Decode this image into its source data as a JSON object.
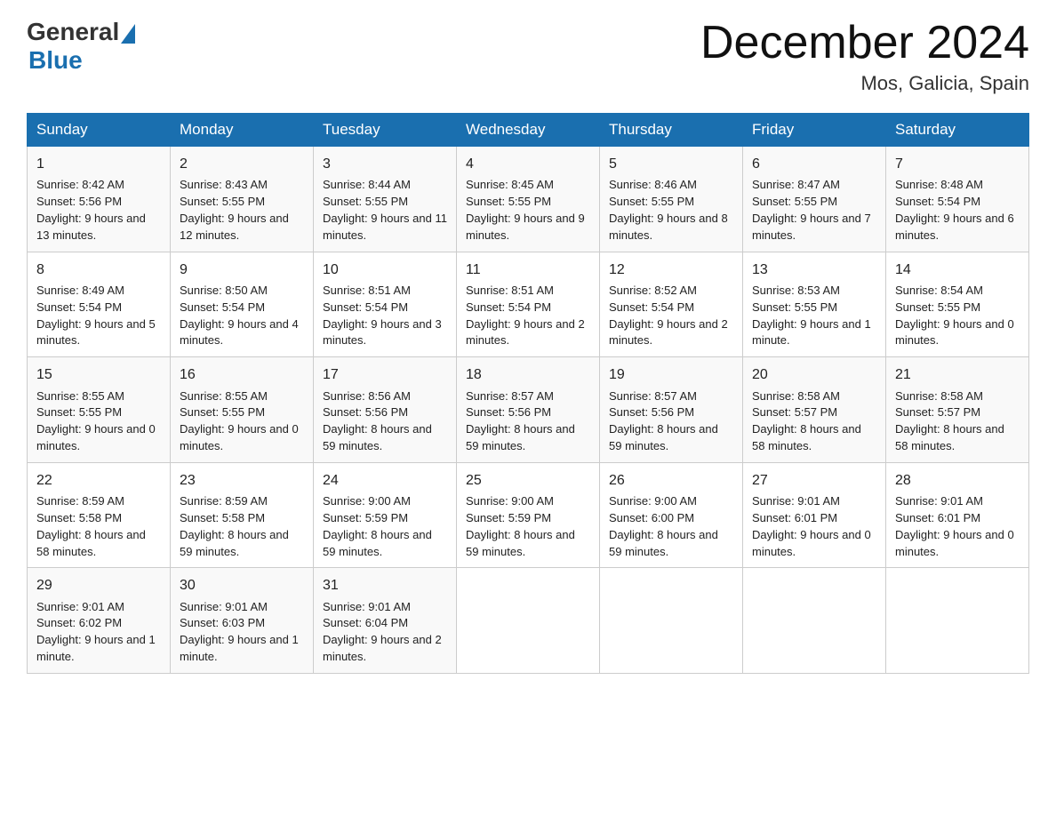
{
  "header": {
    "logo_general": "General",
    "logo_blue": "Blue",
    "title": "December 2024",
    "location": "Mos, Galicia, Spain"
  },
  "days_of_week": [
    "Sunday",
    "Monday",
    "Tuesday",
    "Wednesday",
    "Thursday",
    "Friday",
    "Saturday"
  ],
  "weeks": [
    [
      {
        "num": "1",
        "sunrise": "8:42 AM",
        "sunset": "5:56 PM",
        "daylight": "9 hours and 13 minutes."
      },
      {
        "num": "2",
        "sunrise": "8:43 AM",
        "sunset": "5:55 PM",
        "daylight": "9 hours and 12 minutes."
      },
      {
        "num": "3",
        "sunrise": "8:44 AM",
        "sunset": "5:55 PM",
        "daylight": "9 hours and 11 minutes."
      },
      {
        "num": "4",
        "sunrise": "8:45 AM",
        "sunset": "5:55 PM",
        "daylight": "9 hours and 9 minutes."
      },
      {
        "num": "5",
        "sunrise": "8:46 AM",
        "sunset": "5:55 PM",
        "daylight": "9 hours and 8 minutes."
      },
      {
        "num": "6",
        "sunrise": "8:47 AM",
        "sunset": "5:55 PM",
        "daylight": "9 hours and 7 minutes."
      },
      {
        "num": "7",
        "sunrise": "8:48 AM",
        "sunset": "5:54 PM",
        "daylight": "9 hours and 6 minutes."
      }
    ],
    [
      {
        "num": "8",
        "sunrise": "8:49 AM",
        "sunset": "5:54 PM",
        "daylight": "9 hours and 5 minutes."
      },
      {
        "num": "9",
        "sunrise": "8:50 AM",
        "sunset": "5:54 PM",
        "daylight": "9 hours and 4 minutes."
      },
      {
        "num": "10",
        "sunrise": "8:51 AM",
        "sunset": "5:54 PM",
        "daylight": "9 hours and 3 minutes."
      },
      {
        "num": "11",
        "sunrise": "8:51 AM",
        "sunset": "5:54 PM",
        "daylight": "9 hours and 2 minutes."
      },
      {
        "num": "12",
        "sunrise": "8:52 AM",
        "sunset": "5:54 PM",
        "daylight": "9 hours and 2 minutes."
      },
      {
        "num": "13",
        "sunrise": "8:53 AM",
        "sunset": "5:55 PM",
        "daylight": "9 hours and 1 minute."
      },
      {
        "num": "14",
        "sunrise": "8:54 AM",
        "sunset": "5:55 PM",
        "daylight": "9 hours and 0 minutes."
      }
    ],
    [
      {
        "num": "15",
        "sunrise": "8:55 AM",
        "sunset": "5:55 PM",
        "daylight": "9 hours and 0 minutes."
      },
      {
        "num": "16",
        "sunrise": "8:55 AM",
        "sunset": "5:55 PM",
        "daylight": "9 hours and 0 minutes."
      },
      {
        "num": "17",
        "sunrise": "8:56 AM",
        "sunset": "5:56 PM",
        "daylight": "8 hours and 59 minutes."
      },
      {
        "num": "18",
        "sunrise": "8:57 AM",
        "sunset": "5:56 PM",
        "daylight": "8 hours and 59 minutes."
      },
      {
        "num": "19",
        "sunrise": "8:57 AM",
        "sunset": "5:56 PM",
        "daylight": "8 hours and 59 minutes."
      },
      {
        "num": "20",
        "sunrise": "8:58 AM",
        "sunset": "5:57 PM",
        "daylight": "8 hours and 58 minutes."
      },
      {
        "num": "21",
        "sunrise": "8:58 AM",
        "sunset": "5:57 PM",
        "daylight": "8 hours and 58 minutes."
      }
    ],
    [
      {
        "num": "22",
        "sunrise": "8:59 AM",
        "sunset": "5:58 PM",
        "daylight": "8 hours and 58 minutes."
      },
      {
        "num": "23",
        "sunrise": "8:59 AM",
        "sunset": "5:58 PM",
        "daylight": "8 hours and 59 minutes."
      },
      {
        "num": "24",
        "sunrise": "9:00 AM",
        "sunset": "5:59 PM",
        "daylight": "8 hours and 59 minutes."
      },
      {
        "num": "25",
        "sunrise": "9:00 AM",
        "sunset": "5:59 PM",
        "daylight": "8 hours and 59 minutes."
      },
      {
        "num": "26",
        "sunrise": "9:00 AM",
        "sunset": "6:00 PM",
        "daylight": "8 hours and 59 minutes."
      },
      {
        "num": "27",
        "sunrise": "9:01 AM",
        "sunset": "6:01 PM",
        "daylight": "9 hours and 0 minutes."
      },
      {
        "num": "28",
        "sunrise": "9:01 AM",
        "sunset": "6:01 PM",
        "daylight": "9 hours and 0 minutes."
      }
    ],
    [
      {
        "num": "29",
        "sunrise": "9:01 AM",
        "sunset": "6:02 PM",
        "daylight": "9 hours and 1 minute."
      },
      {
        "num": "30",
        "sunrise": "9:01 AM",
        "sunset": "6:03 PM",
        "daylight": "9 hours and 1 minute."
      },
      {
        "num": "31",
        "sunrise": "9:01 AM",
        "sunset": "6:04 PM",
        "daylight": "9 hours and 2 minutes."
      },
      null,
      null,
      null,
      null
    ]
  ]
}
